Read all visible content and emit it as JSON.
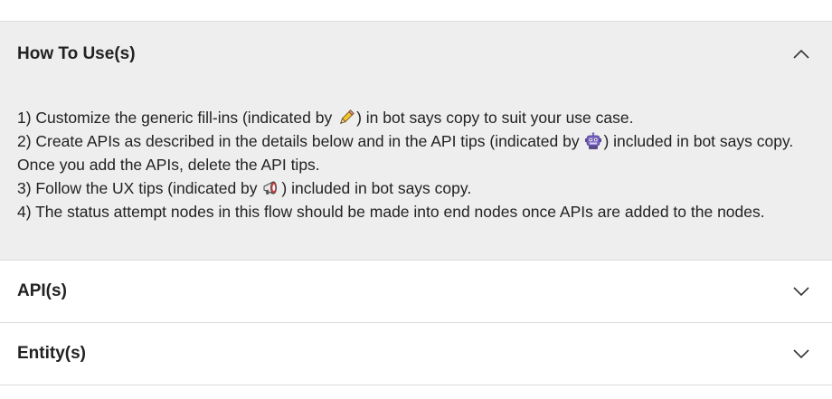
{
  "sections": [
    {
      "title": "How To Use(s)",
      "expanded": true,
      "lines": {
        "l1a": "1) Customize the generic fill-ins (indicated by ",
        "l1b": ") in bot says copy to suit your use case.",
        "l2a": "2) Create APIs as described in the details below and in the API tips (indicated by ",
        "l2b": ") included in bot says copy.",
        "l3": "Once you add the APIs, delete the API tips.",
        "l4a": "3) Follow the UX tips (indicated by ",
        "l4b": ") included in bot says copy.",
        "l5": "4) The status attempt nodes in this flow should be made into end nodes once APIs are added to the nodes."
      },
      "icons": [
        "pencil-icon",
        "robot-icon",
        "megaphone-icon"
      ]
    },
    {
      "title": "API(s)",
      "expanded": false
    },
    {
      "title": "Entity(s)",
      "expanded": false
    }
  ],
  "colors": {
    "open_background": "#eeeeee",
    "divider": "#dcdcdc",
    "text": "#222222"
  }
}
